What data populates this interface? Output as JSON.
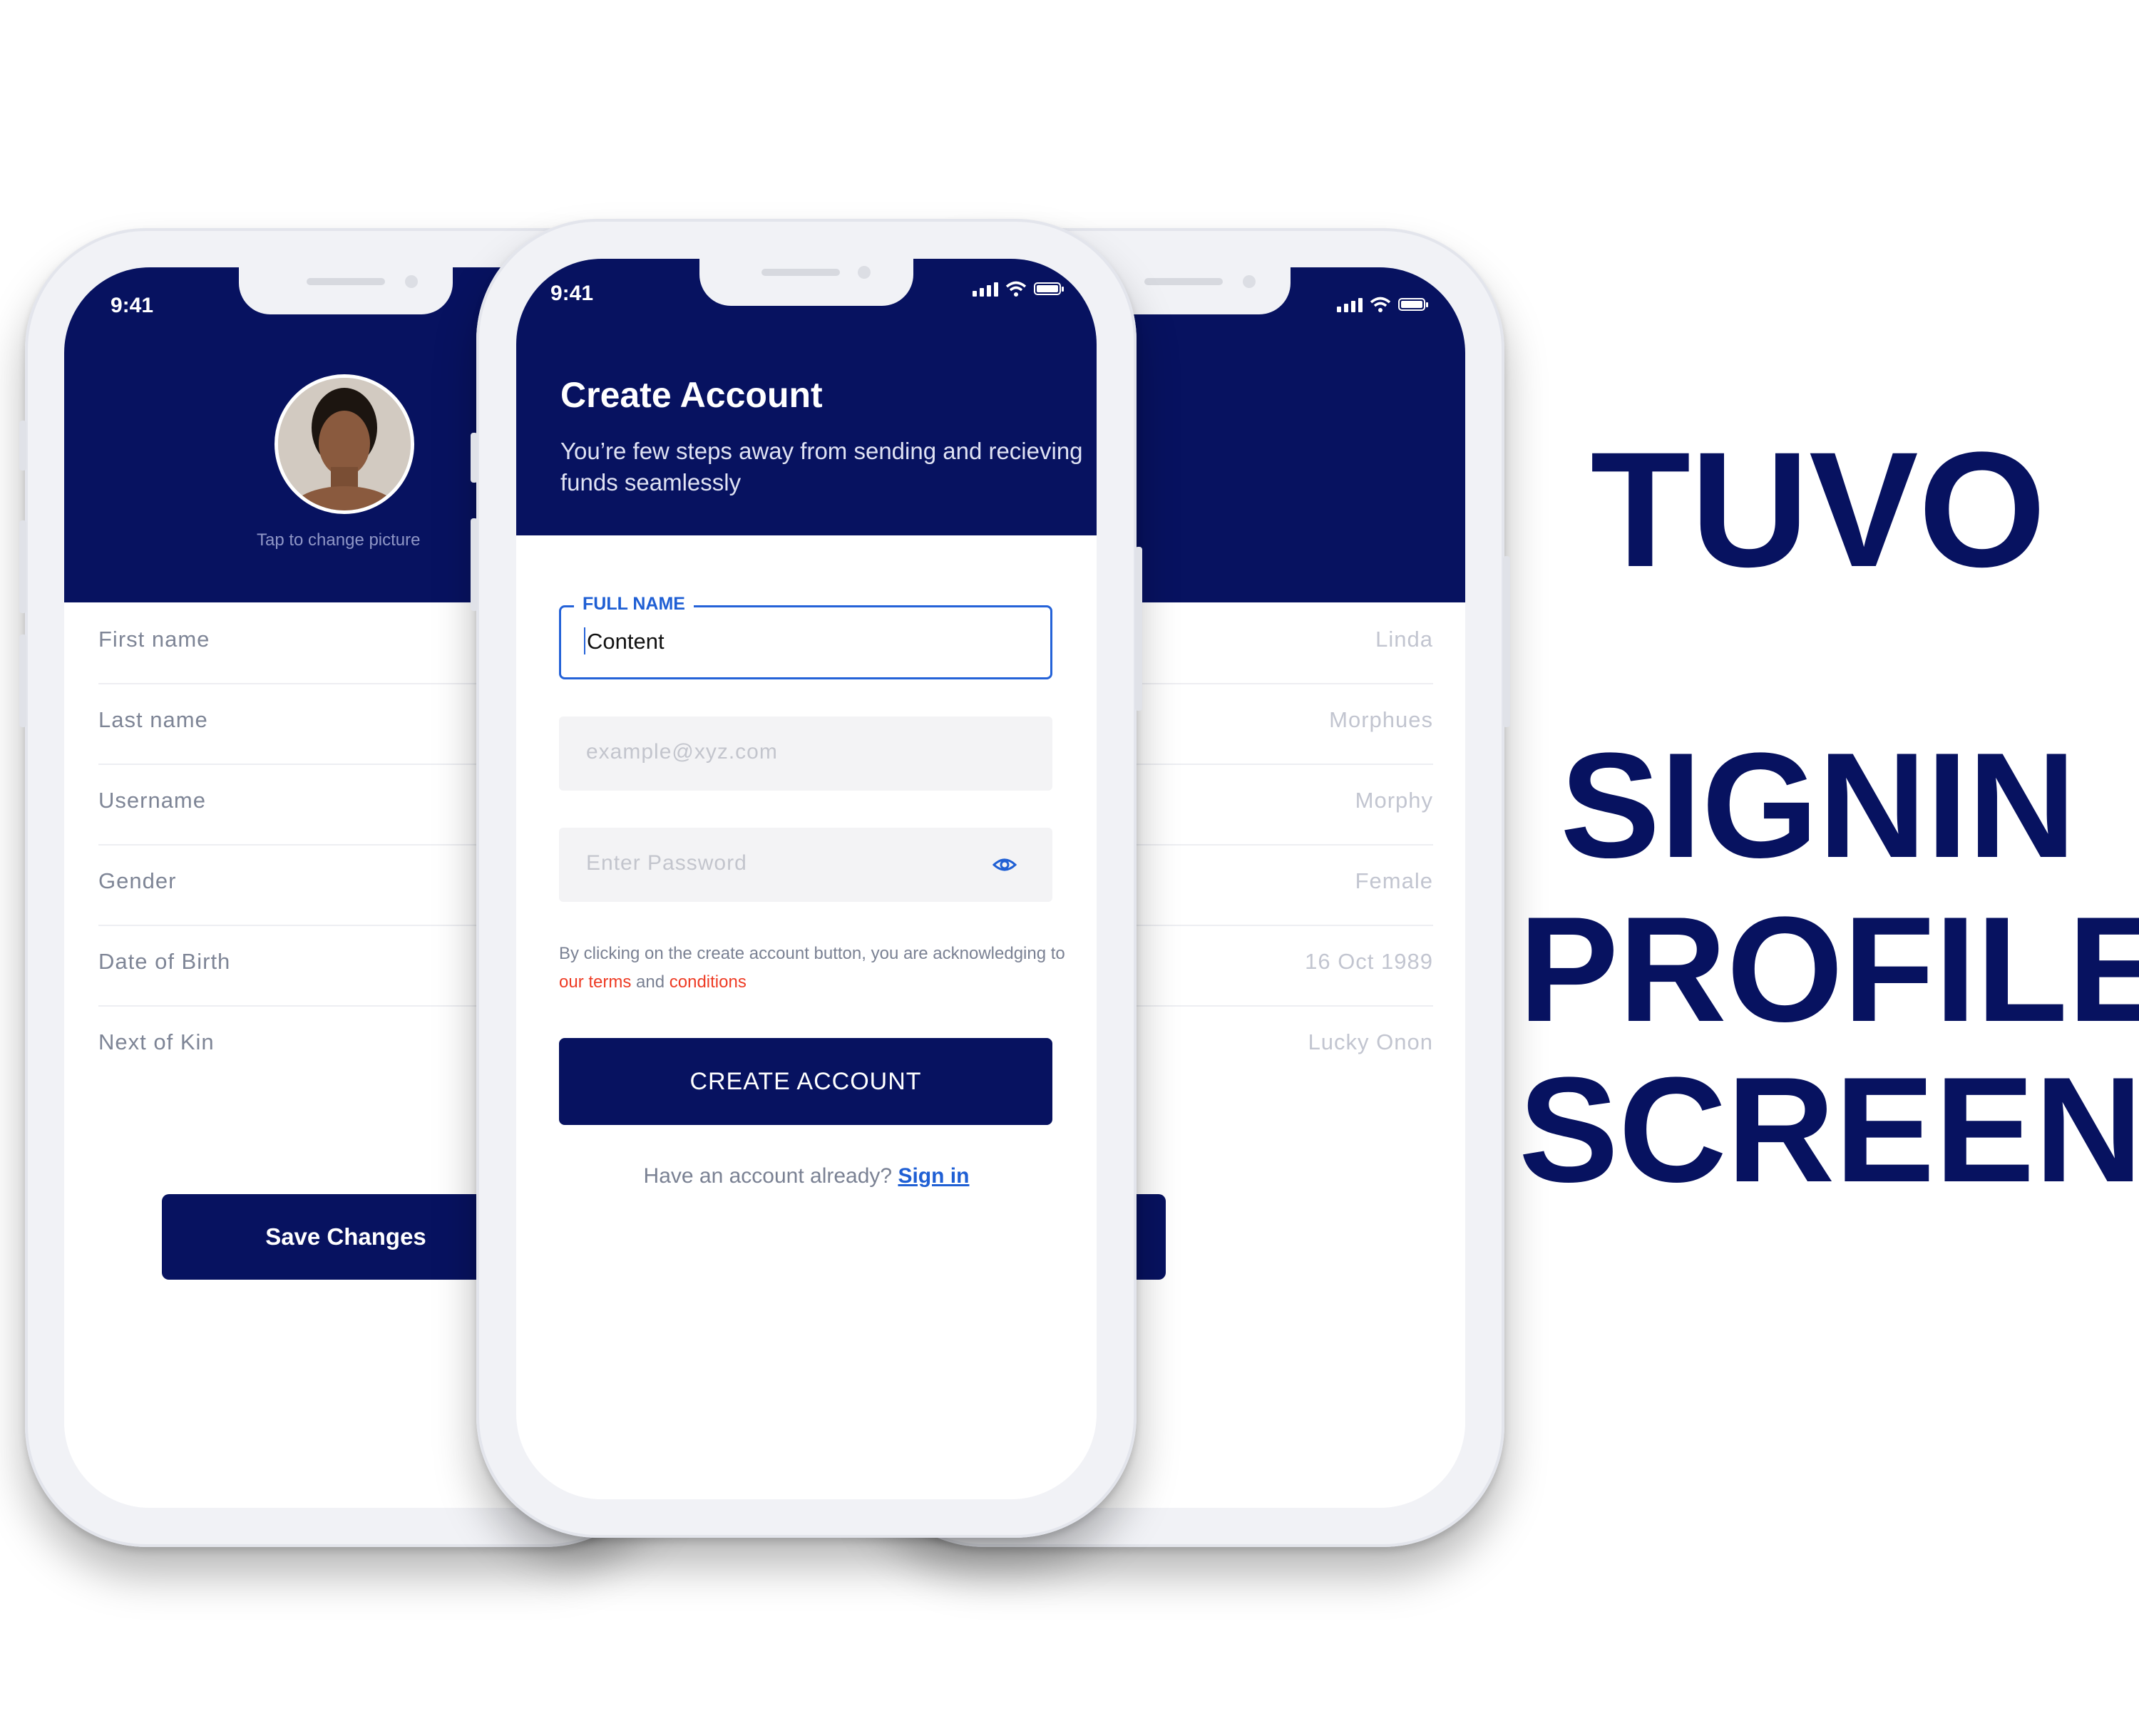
{
  "status": {
    "time": "9:41"
  },
  "profile": {
    "tap_label": "Tap to change picture",
    "fields": [
      {
        "label": "First name",
        "value": "Linda"
      },
      {
        "label": "Last name",
        "value": "Morphues"
      },
      {
        "label": "Username",
        "value": "Morphy"
      },
      {
        "label": "Gender",
        "value": "Female"
      },
      {
        "label": "Date of Birth",
        "value": "16 Oct 1989"
      },
      {
        "label": "Next of Kin",
        "value": "Lucky Onon"
      }
    ],
    "save_label": "Save Changes"
  },
  "signup": {
    "title": "Create Account",
    "subtitle": "You’re few steps away from sending and recieving funds seamlessly",
    "fullname_legend": "FULL NAME",
    "fullname_value": "Content",
    "email_placeholder": "example@xyz.com",
    "password_placeholder": "Enter Password",
    "terms_prefix": "By clicking on the create account button, you are acknowledging to",
    "terms_link": "our terms",
    "terms_and": "and",
    "terms_conditions": "conditions",
    "create_button": "CREATE ACCOUNT",
    "have_account": "Have an account already?",
    "signin_link": "Sign in"
  },
  "headline": {
    "brand": "TUVO",
    "line1": "SIGNIN",
    "line2": "PROFILE",
    "line3": "SCREEN"
  },
  "colors": {
    "navy": "#071260",
    "blue": "#1f5fd4",
    "red": "#ee3b24"
  }
}
